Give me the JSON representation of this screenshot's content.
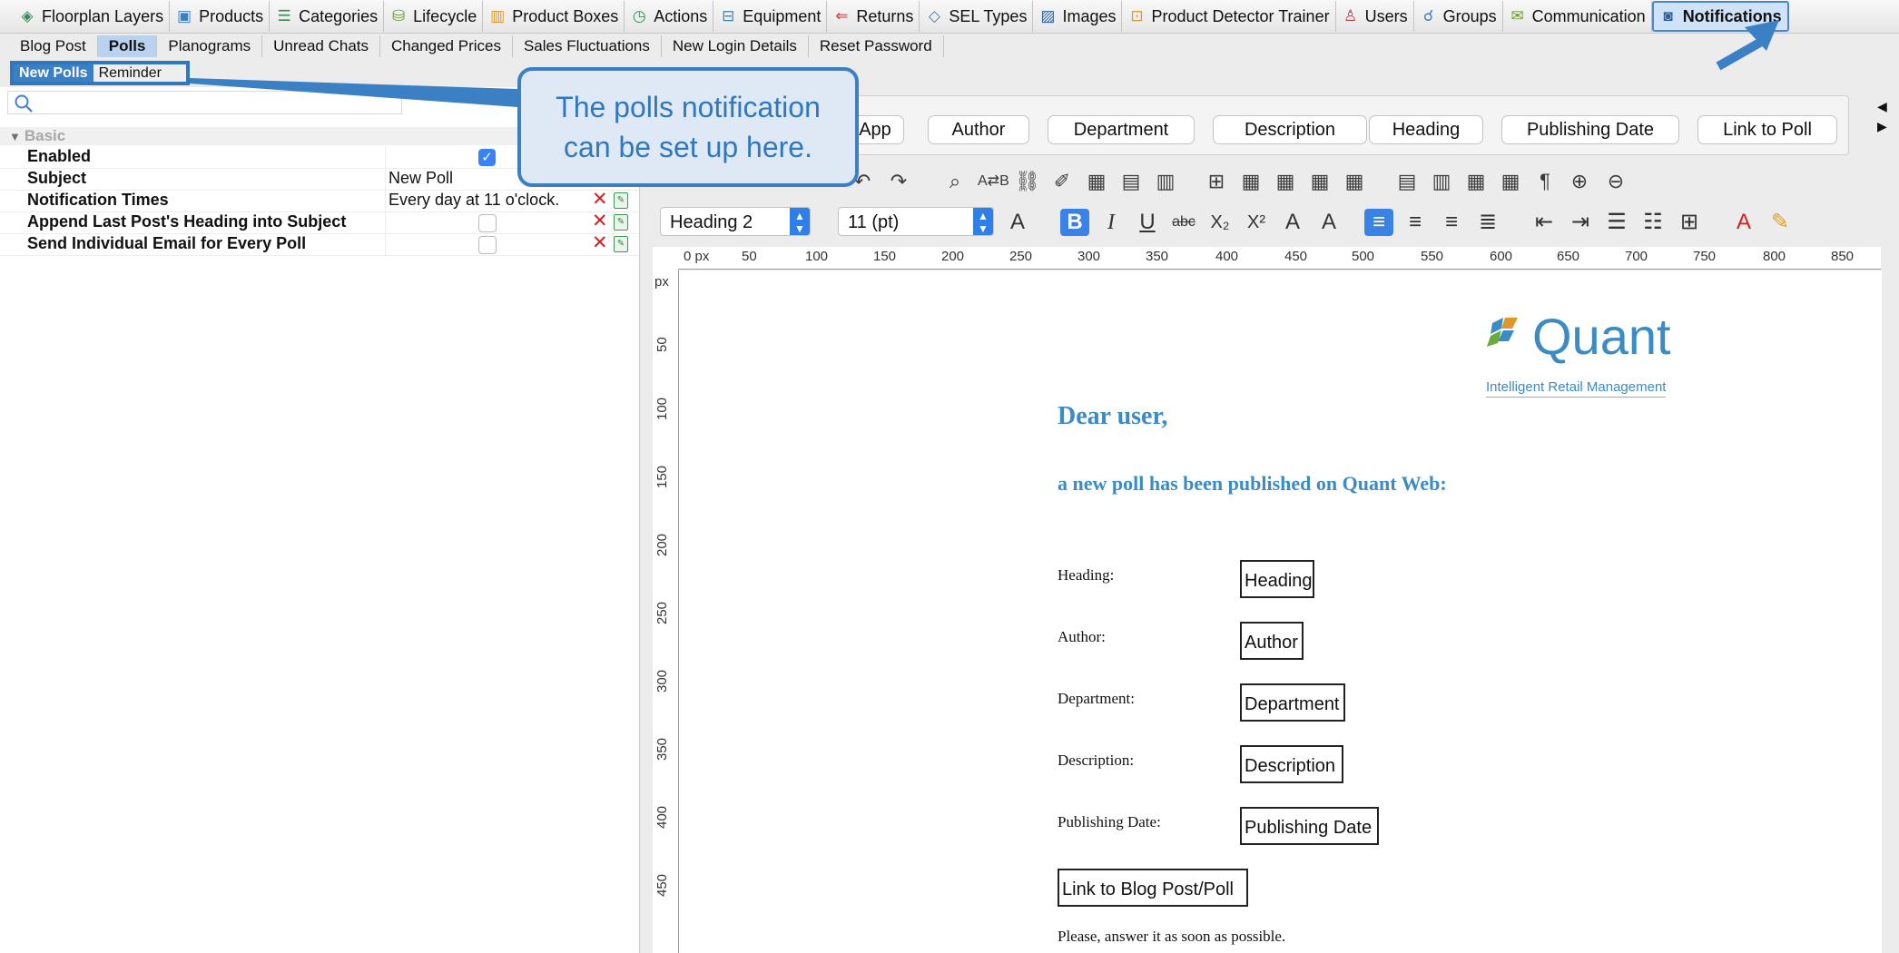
{
  "top_tabs": [
    {
      "label": "Floorplan Layers",
      "icon": "layers-icon"
    },
    {
      "label": "Products",
      "icon": "products-icon"
    },
    {
      "label": "Categories",
      "icon": "categories-icon"
    },
    {
      "label": "Lifecycle",
      "icon": "lifecycle-icon"
    },
    {
      "label": "Product Boxes",
      "icon": "product-boxes-icon"
    },
    {
      "label": "Actions",
      "icon": "actions-icon"
    },
    {
      "label": "Equipment",
      "icon": "equipment-icon"
    },
    {
      "label": "Returns",
      "icon": "returns-icon"
    },
    {
      "label": "SEL Types",
      "icon": "tag-icon"
    },
    {
      "label": "Images",
      "icon": "image-icon"
    },
    {
      "label": "Product Detector Trainer",
      "icon": "trainer-icon"
    },
    {
      "label": "Users",
      "icon": "user-icon"
    },
    {
      "label": "Groups",
      "icon": "groups-icon"
    },
    {
      "label": "Communication",
      "icon": "mail-icon"
    },
    {
      "label": "Notifications",
      "icon": "notification-icon",
      "active": true
    }
  ],
  "sub_tabs": [
    {
      "label": "Blog Post"
    },
    {
      "label": "Polls",
      "active": true
    },
    {
      "label": "Planograms"
    },
    {
      "label": "Unread Chats"
    },
    {
      "label": "Changed Prices"
    },
    {
      "label": "Sales Fluctuations"
    },
    {
      "label": "New Login Details"
    },
    {
      "label": "Reset Password"
    }
  ],
  "third_tabs": [
    {
      "label": "New Polls",
      "active": true
    },
    {
      "label": "Reminder"
    }
  ],
  "properties": {
    "group_label": "Basic",
    "rows": [
      {
        "name": "Enabled",
        "checked": true
      },
      {
        "name": "Subject",
        "value": "New Poll"
      },
      {
        "name": "Notification Times",
        "value": "Every day at 11 o'clock."
      },
      {
        "name": "Append Last Post's Heading into Subject",
        "checked": false
      },
      {
        "name": "Send Individual Email for Every Poll",
        "checked": false
      }
    ]
  },
  "callout": {
    "line1": "The polls notification",
    "line2": "can be set up here."
  },
  "field_buttons": [
    "App",
    "Author",
    "Department",
    "Description",
    "Heading",
    "Publishing Date",
    "Link to Poll"
  ],
  "format": {
    "style": "Heading 2",
    "size": "11 (pt)"
  },
  "ruler": {
    "h_labels": [
      "0 px",
      "50",
      "100",
      "150",
      "200",
      "250",
      "300",
      "350",
      "400",
      "450",
      "500",
      "550",
      "600",
      "650",
      "700",
      "750",
      "800",
      "850"
    ],
    "v_labels": [
      "px",
      "50",
      "100",
      "150",
      "200",
      "250",
      "300",
      "350",
      "400",
      "450"
    ]
  },
  "document": {
    "logo_name": "Quant",
    "logo_tagline": "Intelligent Retail Management",
    "greeting": "Dear user,",
    "intro": "a new poll has been published on Quant Web:",
    "fields": [
      {
        "label": "Heading:",
        "value": "Heading"
      },
      {
        "label": "Author:",
        "value": "Author"
      },
      {
        "label": "Department:",
        "value": "Department"
      },
      {
        "label": "Description:",
        "value": "Description"
      },
      {
        "label": "Publishing Date:",
        "value": "Publishing Date"
      }
    ],
    "link_field": "Link to Blog Post/Poll",
    "closing": "Please, answer it as soon as possible."
  },
  "colors": {
    "accent": "#2f78be",
    "doc_blue": "#3b8bc4",
    "active_tab": "#cfe2f8"
  }
}
